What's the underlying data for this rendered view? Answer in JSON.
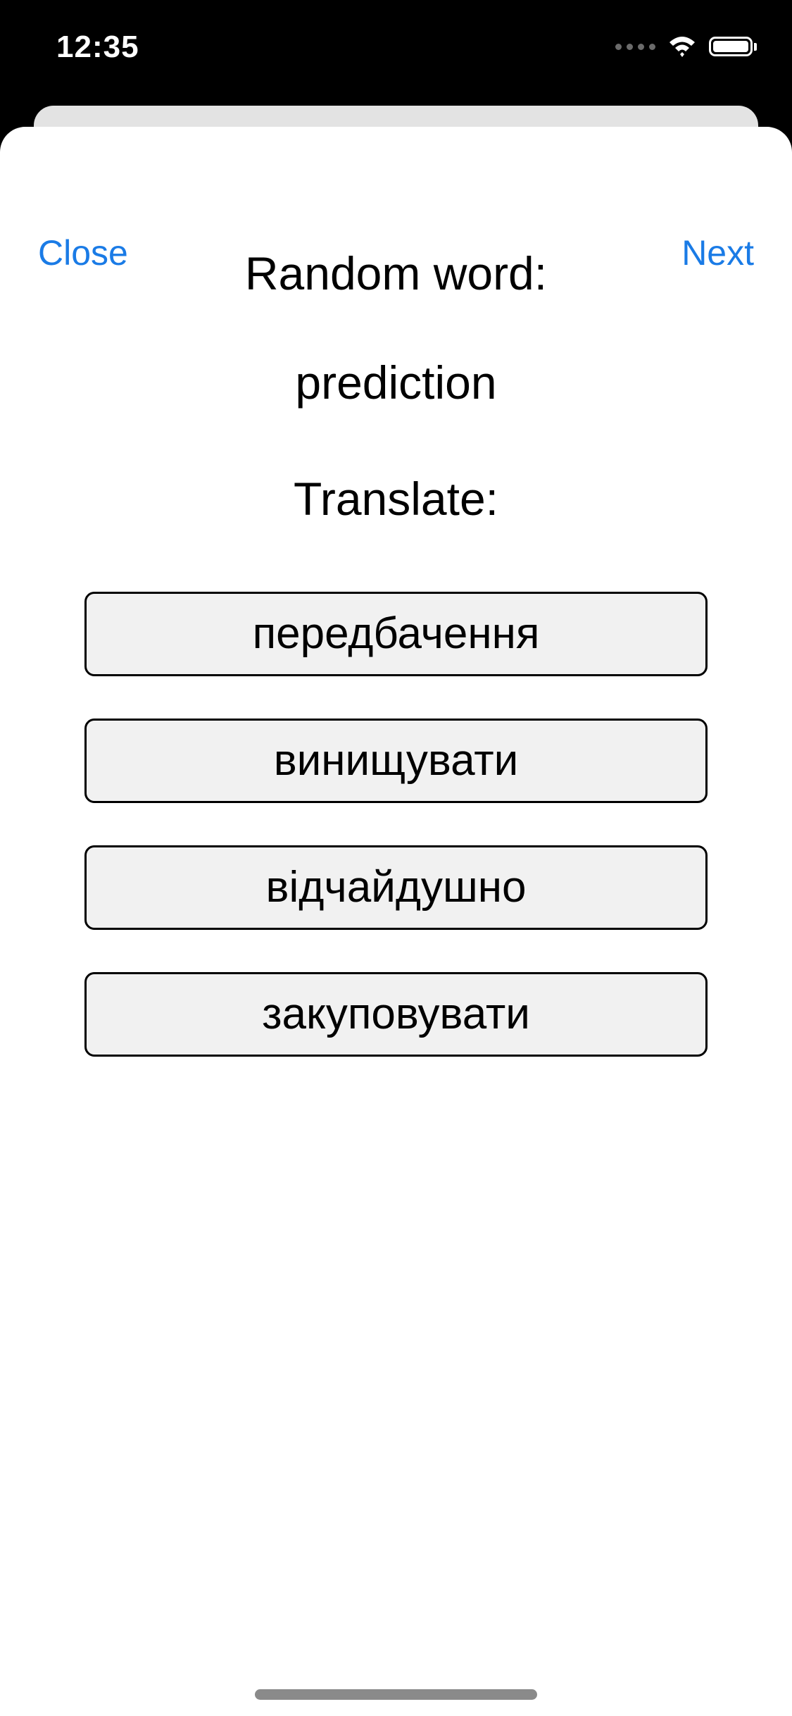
{
  "status_bar": {
    "time": "12:35",
    "icons": [
      "cellular-signal-icon",
      "wifi-icon",
      "battery-icon"
    ]
  },
  "nav": {
    "close_label": "Close",
    "next_label": "Next"
  },
  "quiz": {
    "random_word_heading": "Random word:",
    "word": "prediction",
    "translate_heading": "Translate:",
    "options": [
      "передбачення",
      "винищувати",
      "відчайдушно",
      "закуповувати"
    ]
  },
  "colors": {
    "accent": "#1a7be6",
    "button_background": "#f1f1f1",
    "button_border": "#000000",
    "sheet_background": "#ffffff",
    "status_bar_background": "#000000"
  }
}
